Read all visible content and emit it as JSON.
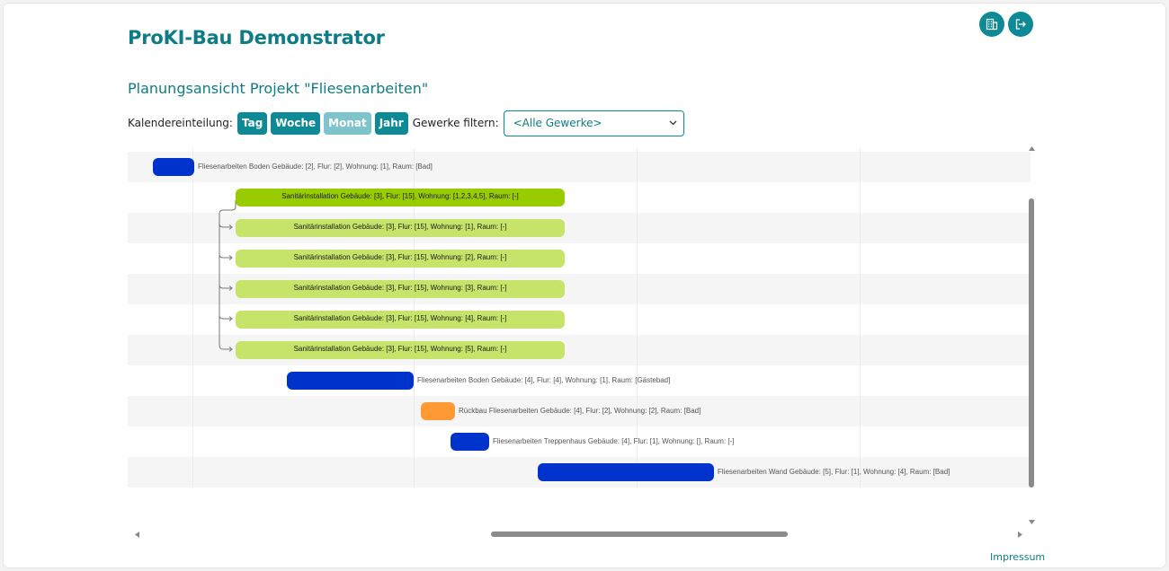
{
  "app": {
    "title": "ProKI-Bau Demonstrator"
  },
  "header": {
    "icons": [
      {
        "name": "building-icon"
      },
      {
        "name": "logout-icon"
      }
    ]
  },
  "page": {
    "subtitle": "Planungsansicht Projekt \"Fliesenarbeiten\""
  },
  "toolbar": {
    "calendar_label": "Kalendereinteilung:",
    "buttons": [
      {
        "label": "Tag",
        "disabled": false
      },
      {
        "label": "Woche",
        "disabled": false
      },
      {
        "label": "Monat",
        "disabled": true
      },
      {
        "label": "Jahr",
        "disabled": false
      }
    ],
    "filter_label": "Gewerke filtern:",
    "filter_value": "<Alle Gewerke>"
  },
  "colors": {
    "accent": "#0e8a96",
    "blue": "#0033cc",
    "green_dark": "#99cc00",
    "green_light": "#c6e36a",
    "orange": "#ff9933"
  },
  "gantt": {
    "tasks": [
      {
        "label": "Fliesenarbeiten Boden Gebäude: [2], Flur: [2], Wohnung: [1], Raum: [Bad]",
        "color": "blue",
        "label_inside": false
      },
      {
        "label": "Sanitärinstallation Gebäude: [3], Flur: [15], Wohnung: [1,2,3,4,5], Raum: [-]",
        "color": "green_dark",
        "label_inside": true
      },
      {
        "label": "Sanitärinstallation Gebäude: [3], Flur: [15], Wohnung: [1], Raum: [-]",
        "color": "green_light",
        "label_inside": true
      },
      {
        "label": "Sanitärinstallation Gebäude: [3], Flur: [15], Wohnung: [2], Raum: [-]",
        "color": "green_light",
        "label_inside": true
      },
      {
        "label": "Sanitärinstallation Gebäude: [3], Flur: [15], Wohnung: [3], Raum: [-]",
        "color": "green_light",
        "label_inside": true
      },
      {
        "label": "Sanitärinstallation Gebäude: [3], Flur: [15], Wohnung: [4], Raum: [-]",
        "color": "green_light",
        "label_inside": true
      },
      {
        "label": "Sanitärinstallation Gebäude: [3], Flur: [15], Wohnung: [5], Raum: [-]",
        "color": "green_light",
        "label_inside": true
      },
      {
        "label": "Fliesenarbeiten Boden Gebäude: [4], Flur: [4], Wohnung: [1], Raum: [Gästebad]",
        "color": "blue",
        "label_inside": false
      },
      {
        "label": "Rückbau Fliesenarbeiten Gebäude: [4], Flur: [2], Wohnung: [2], Raum: [Bad]",
        "color": "orange",
        "label_inside": false
      },
      {
        "label": "Fliesenarbeiten Treppenhaus Gebäude: [4], Flur: [1], Wohnung: [], Raum: [-]",
        "color": "blue",
        "label_inside": false
      },
      {
        "label": "Fliesenarbeiten Wand Gebäude: [5], Flur: [1], Wohnung: [4], Raum: [Bad]",
        "color": "blue",
        "label_inside": false
      }
    ]
  },
  "footer": {
    "impressum": "Impressum"
  }
}
